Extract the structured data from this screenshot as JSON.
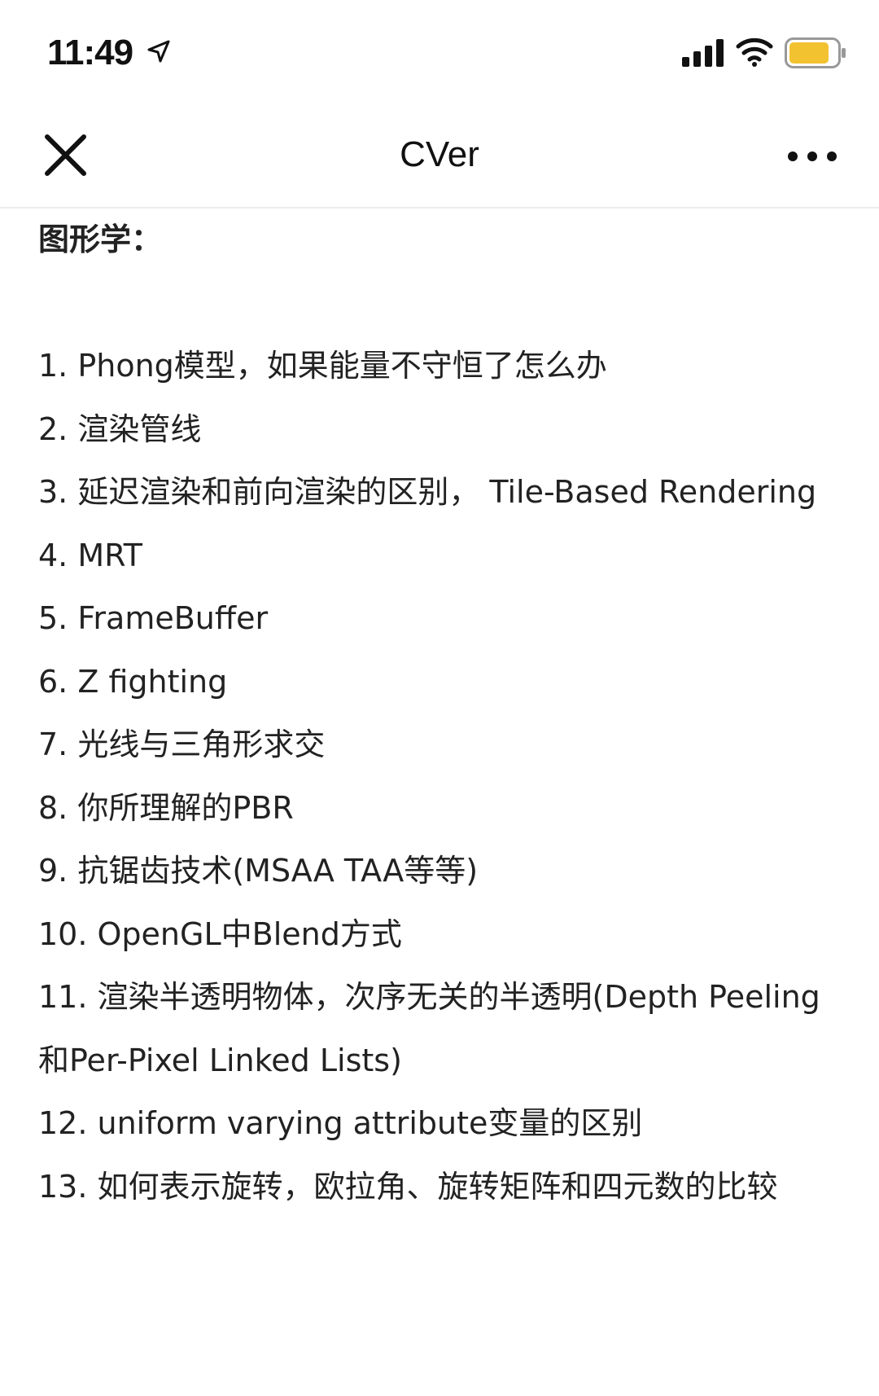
{
  "status_bar": {
    "time": "11:49",
    "location_icon": "location-arrow-icon",
    "signal_icon": "cellular-signal-icon",
    "wifi_icon": "wifi-icon",
    "battery_icon": "battery-icon",
    "battery_color": "#f2c230"
  },
  "nav": {
    "title": "CVer",
    "close_icon": "close-icon",
    "more_icon": "more-options-icon"
  },
  "article": {
    "heading": "图形学：",
    "items": [
      "1. Phong模型，如果能量不守恒了怎么办",
      "2. 渲染管线",
      "3. 延迟渲染和前向渲染的区别， Tile-Based Rendering",
      "4. MRT",
      "5. FrameBuffer",
      "6. Z fighting",
      "7. 光线与三角形求交",
      "8. 你所理解的PBR",
      "9. 抗锯齿技术(MSAA TAA等等)",
      "10. OpenGL中Blend方式",
      "11. 渲染半透明物体，次序无关的半透明(Depth Peeling和Per-Pixel Linked Lists)",
      "12. uniform varying attribute变量的区别",
      "13. 如何表示旋转，欧拉角、旋转矩阵和四元数的比较"
    ]
  }
}
